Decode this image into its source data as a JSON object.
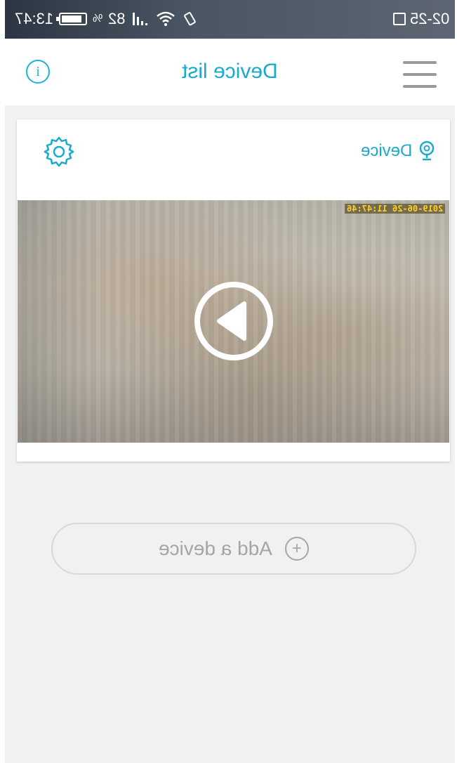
{
  "status_bar": {
    "time": "13:47",
    "battery": "82",
    "date": "02-25",
    "battery_unit": "%"
  },
  "header": {
    "title": "Device list"
  },
  "device_card": {
    "device_name": "Device",
    "timestamp": "2019-06-26 11:47:46"
  },
  "add_device": {
    "label": "Add a device"
  },
  "colors": {
    "accent": "#1aa9cf",
    "background": "#f1f1f1",
    "status_bar": "#4a5563"
  },
  "icons": {
    "info": "info-icon",
    "menu": "hamburger-menu-icon",
    "settings": "gear-icon",
    "device": "camera-pin-icon",
    "play": "play-icon",
    "add": "plus-circle-icon"
  }
}
